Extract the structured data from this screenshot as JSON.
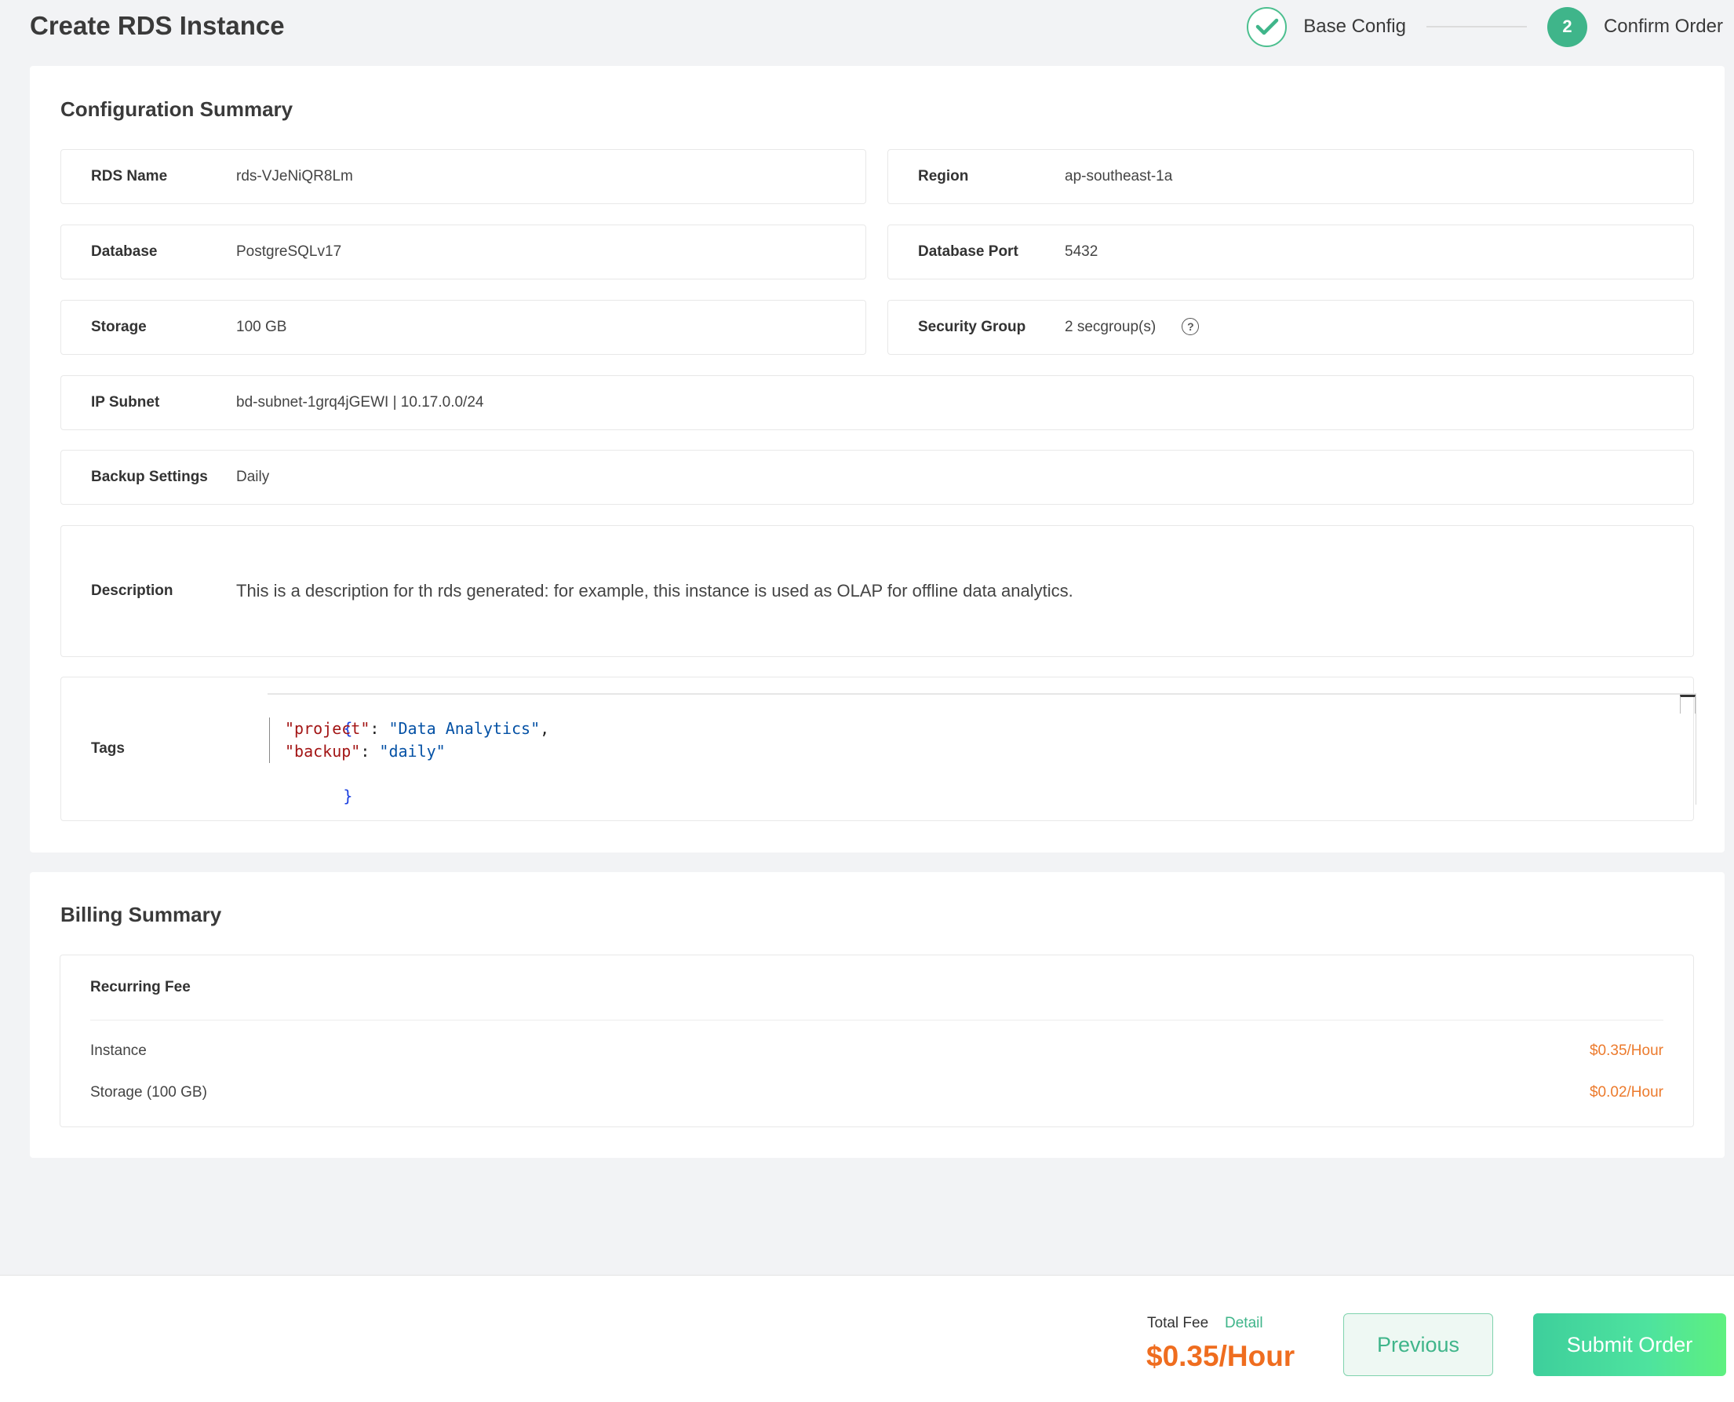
{
  "header": {
    "title": "Create RDS Instance",
    "steps": [
      {
        "label": "Base Config",
        "status": "done"
      },
      {
        "label": "Confirm Order",
        "number": "2",
        "status": "active"
      }
    ]
  },
  "config": {
    "title": "Configuration Summary",
    "fields": {
      "rds_name": {
        "label": "RDS Name",
        "value": "rds-VJeNiQR8Lm"
      },
      "region": {
        "label": "Region",
        "value": "ap-southeast-1a"
      },
      "database": {
        "label": "Database",
        "value": "PostgreSQLv17"
      },
      "database_port": {
        "label": "Database Port",
        "value": "5432"
      },
      "storage": {
        "label": "Storage",
        "value": "100 GB"
      },
      "security_group": {
        "label": "Security Group",
        "value": "2 secgroup(s)",
        "help_icon": "?"
      },
      "ip_subnet": {
        "label": "IP Subnet",
        "value": "bd-subnet-1grq4jGEWI | 10.17.0.0/24"
      },
      "backup": {
        "label": "Backup Settings",
        "value": "Daily"
      },
      "description": {
        "label": "Description",
        "value": "This is a description for th rds generated: for example, this instance is used as OLAP for offline data analytics."
      },
      "tags": {
        "label": "Tags",
        "open_brace": "{",
        "close_brace": "}",
        "entries": [
          {
            "key": "\"project\"",
            "value": "\"Data Analytics\"",
            "trail": ","
          },
          {
            "key": "\"backup\"",
            "value": "\"daily\"",
            "trail": ""
          }
        ],
        "colon": ": "
      }
    }
  },
  "billing": {
    "title": "Billing Summary",
    "recurring_title": "Recurring Fee",
    "items": [
      {
        "label": "Instance",
        "price": "$0.35/Hour"
      },
      {
        "label": "Storage (100 GB)",
        "price": "$0.02/Hour"
      }
    ]
  },
  "footer": {
    "total_label": "Total Fee",
    "detail_link": "Detail",
    "total_value": "$0.35/Hour",
    "previous_label": "Previous",
    "submit_label": "Submit Order"
  },
  "colors": {
    "accent_green": "#3fb58a",
    "price_orange": "#ef6d1f"
  }
}
